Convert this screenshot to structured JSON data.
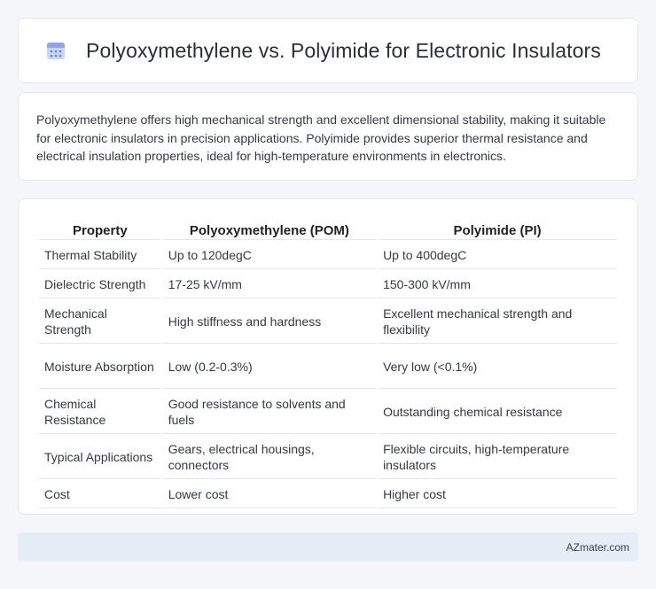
{
  "header": {
    "title": "Polyoxymethylene vs. Polyimide for Electronic Insulators",
    "icon": "calendar-icon"
  },
  "intro": {
    "text": "Polyoxymethylene offers high mechanical strength and excellent dimensional stability, making it suitable for electronic insulators in precision applications. Polyimide provides superior thermal resistance and electrical insulation properties, ideal for high-temperature environments in electronics."
  },
  "table": {
    "headers": [
      "Property",
      "Polyoxymethylene (POM)",
      "Polyimide (PI)"
    ],
    "rows": [
      [
        "Thermal Stability",
        "Up to 120degC",
        "Up to 400degC"
      ],
      [
        "Dielectric Strength",
        "17-25 kV/mm",
        "150-300 kV/mm"
      ],
      [
        "Mechanical Strength",
        "High stiffness and hardness",
        "Excellent mechanical strength and flexibility"
      ],
      [
        "Moisture Absorption",
        "Low (0.2-0.3%)",
        "Very low (<0.1%)"
      ],
      [
        "Chemical Resistance",
        "Good resistance to solvents and fuels",
        "Outstanding chemical resistance"
      ],
      [
        "Typical Applications",
        "Gears, electrical housings, connectors",
        "Flexible circuits, high-temperature insulators"
      ],
      [
        "Cost",
        "Lower cost",
        "Higher cost"
      ]
    ]
  },
  "footer": {
    "text": "AZmater.com"
  },
  "colors": {
    "page_background": "#f4f6f9",
    "footer_background": "#e6edf7",
    "icon_accent": "#8ea6e8"
  }
}
